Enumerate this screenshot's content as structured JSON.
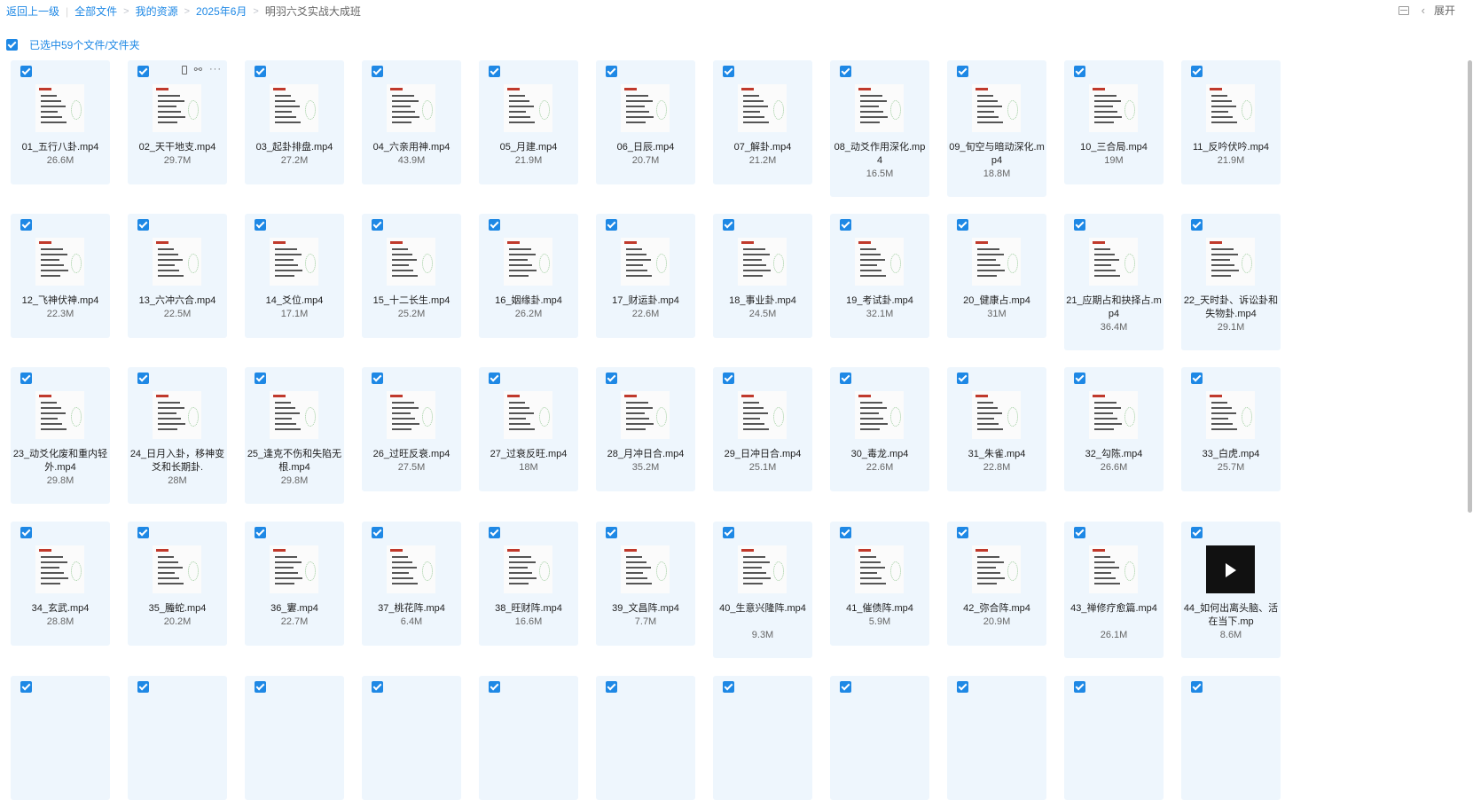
{
  "breadcrumb": {
    "back": "返回上一级",
    "all_files": "全部文件",
    "my_resources": "我的资源",
    "month_folder": "2025年6月",
    "current": "明羽六爻实战大成班"
  },
  "toolbar": {
    "expand_label": "展开"
  },
  "selection": {
    "text": "已选中59个文件/文件夹"
  },
  "files": [
    {
      "name": "01_五行八卦.mp4",
      "size": "26.6M"
    },
    {
      "name": "02_天干地支.mp4",
      "size": "29.7M"
    },
    {
      "name": "03_起卦排盘.mp4",
      "size": "27.2M"
    },
    {
      "name": "04_六亲用神.mp4",
      "size": "43.9M"
    },
    {
      "name": "05_月建.mp4",
      "size": "21.9M"
    },
    {
      "name": "06_日辰.mp4",
      "size": "20.7M"
    },
    {
      "name": "07_解卦.mp4",
      "size": "21.2M"
    },
    {
      "name": "08_动爻作用深化.mp4",
      "size": "16.5M"
    },
    {
      "name": "09_旬空与暗动深化.mp4",
      "size": "18.8M"
    },
    {
      "name": "10_三合局.mp4",
      "size": "19M"
    },
    {
      "name": "11_反吟伏吟.mp4",
      "size": "21.9M"
    },
    {
      "name": "12_飞神伏神.mp4",
      "size": "22.3M"
    },
    {
      "name": "13_六冲六合.mp4",
      "size": "22.5M"
    },
    {
      "name": "14_爻位.mp4",
      "size": "17.1M"
    },
    {
      "name": "15_十二长生.mp4",
      "size": "25.2M"
    },
    {
      "name": "16_姻缘卦.mp4",
      "size": "26.2M"
    },
    {
      "name": "17_财运卦.mp4",
      "size": "22.6M"
    },
    {
      "name": "18_事业卦.mp4",
      "size": "24.5M"
    },
    {
      "name": "19_考试卦.mp4",
      "size": "32.1M"
    },
    {
      "name": "20_健康占.mp4",
      "size": "31M"
    },
    {
      "name": "21_应期占和抉择占.mp4",
      "size": "36.4M"
    },
    {
      "name": "22_天时卦、诉讼卦和失物卦.mp4",
      "size": "29.1M"
    },
    {
      "name": "23_动爻化废和重内轻外.mp4",
      "size": "29.8M"
    },
    {
      "name": "24_日月入卦，移神变爻和长期卦.",
      "size": "28M"
    },
    {
      "name": "25_逢克不伤和失陷无根.mp4",
      "size": "29.8M"
    },
    {
      "name": "26_过旺反衰.mp4",
      "size": "27.5M"
    },
    {
      "name": "27_过衰反旺.mp4",
      "size": "18M"
    },
    {
      "name": "28_月冲日合.mp4",
      "size": "35.2M"
    },
    {
      "name": "29_日冲日合.mp4",
      "size": "25.1M"
    },
    {
      "name": "30_毒龙.mp4",
      "size": "22.6M"
    },
    {
      "name": "31_朱雀.mp4",
      "size": "22.8M"
    },
    {
      "name": "32_勾陈.mp4",
      "size": "26.6M"
    },
    {
      "name": "33_白虎.mp4",
      "size": "25.7M"
    },
    {
      "name": "34_玄武.mp4",
      "size": "28.8M"
    },
    {
      "name": "35_螣蛇.mp4",
      "size": "20.2M"
    },
    {
      "name": "36_寠.mp4",
      "size": "22.7M"
    },
    {
      "name": "37_桃花阵.mp4",
      "size": "6.4M"
    },
    {
      "name": "38_旺财阵.mp4",
      "size": "16.6M"
    },
    {
      "name": "39_文昌阵.mp4",
      "size": "7.7M"
    },
    {
      "name": "40_生意兴隆阵.mp4",
      "size": "9.3M"
    },
    {
      "name": "41_催债阵.mp4",
      "size": "5.9M"
    },
    {
      "name": "42_弥合阵.mp4",
      "size": "20.9M"
    },
    {
      "name": "43_禅修疗愈篇.mp4",
      "size": "26.1M"
    },
    {
      "name": "44_如何出离头脑、活在当下.mp",
      "size": "8.6M"
    },
    {
      "name": "",
      "size": ""
    },
    {
      "name": "",
      "size": ""
    },
    {
      "name": "",
      "size": ""
    },
    {
      "name": "",
      "size": ""
    },
    {
      "name": "",
      "size": ""
    },
    {
      "name": "",
      "size": ""
    },
    {
      "name": "",
      "size": ""
    },
    {
      "name": "",
      "size": ""
    },
    {
      "name": "",
      "size": ""
    },
    {
      "name": "",
      "size": ""
    },
    {
      "name": "",
      "size": ""
    }
  ]
}
